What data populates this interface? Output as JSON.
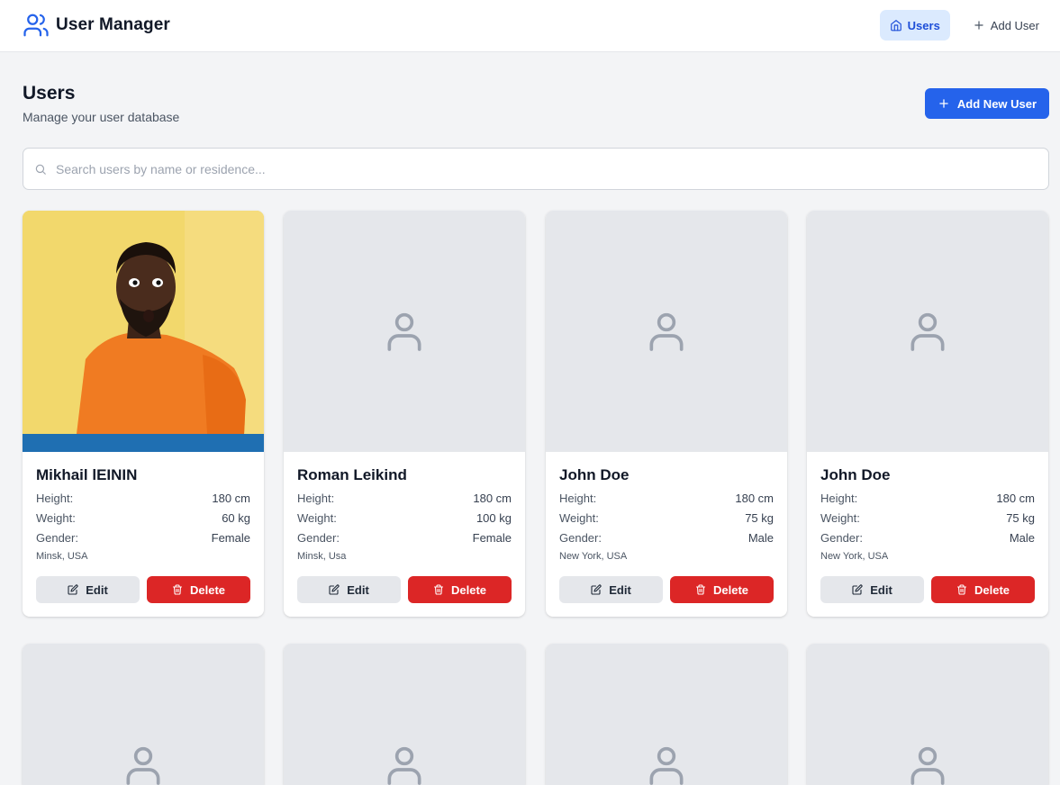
{
  "app": {
    "title": "User Manager"
  },
  "nav": {
    "users_label": "Users",
    "add_user_label": "Add User"
  },
  "header": {
    "title": "Users",
    "subtitle": "Manage your user database",
    "add_button_label": "Add New User"
  },
  "search": {
    "placeholder": "Search users by name or residence...",
    "value": ""
  },
  "labels": {
    "height": "Height:",
    "weight": "Weight:",
    "gender": "Gender:",
    "edit": "Edit",
    "delete": "Delete"
  },
  "users": [
    {
      "name": "Mikhail lEININ",
      "height": "180 cm",
      "weight": "60 kg",
      "gender": "Female",
      "residence": "Minsk, USA",
      "has_photo": true
    },
    {
      "name": "Roman Leikind",
      "height": "180 cm",
      "weight": "100 kg",
      "gender": "Female",
      "residence": "Minsk, Usa",
      "has_photo": false
    },
    {
      "name": "John Doe",
      "height": "180 cm",
      "weight": "75 kg",
      "gender": "Male",
      "residence": "New York, USA",
      "has_photo": false
    },
    {
      "name": "John Doe",
      "height": "180 cm",
      "weight": "75 kg",
      "gender": "Male",
      "residence": "New York, USA",
      "has_photo": false
    }
  ],
  "colors": {
    "primary": "#2563eb",
    "danger": "#dc2626",
    "nav_active_bg": "#dbeafe",
    "placeholder_bg": "#e5e7eb",
    "photo_bg": "#f2d86c"
  },
  "icons": {
    "brand": "users-icon",
    "nav_users": "home-icon",
    "nav_add": "plus-icon",
    "search": "search-icon",
    "placeholder": "user-icon",
    "edit": "edit-icon",
    "delete": "trash-icon"
  }
}
